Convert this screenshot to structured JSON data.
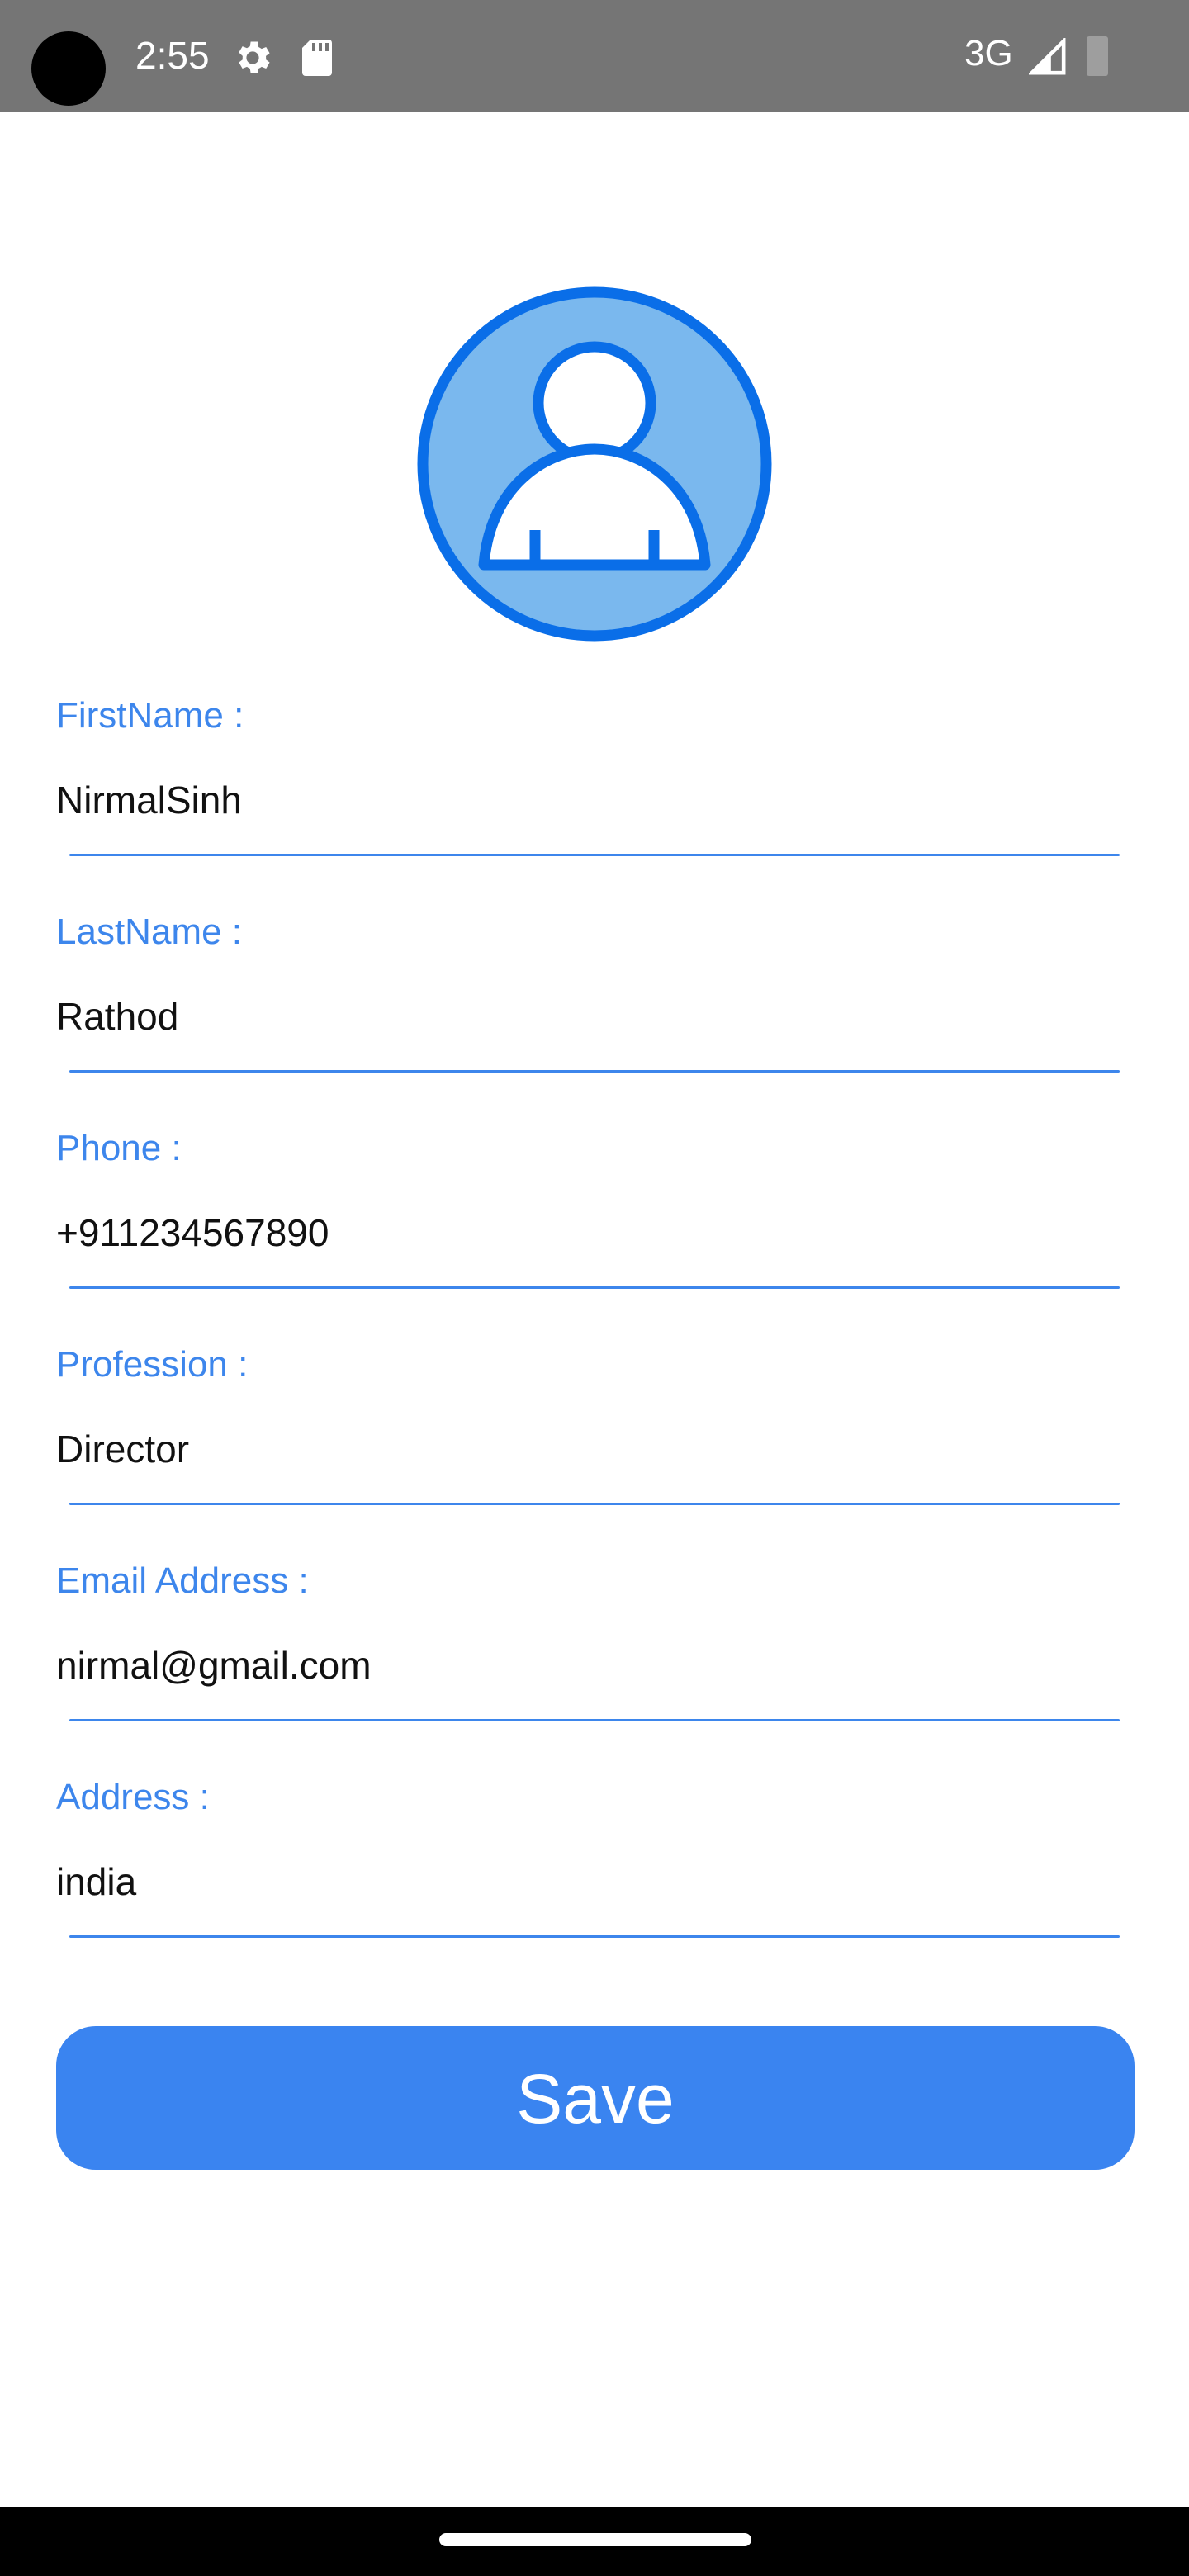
{
  "status_bar": {
    "time": "2:55",
    "network": "3G",
    "icons": [
      "gear-icon",
      "sd-card-icon",
      "signal-icon",
      "battery-icon"
    ]
  },
  "profile": {
    "avatar_icon": "user-avatar-icon",
    "fields": [
      {
        "label": "FirstName :",
        "value": "NirmalSinh"
      },
      {
        "label": "LastName :",
        "value": "Rathod"
      },
      {
        "label": "Phone :",
        "value": "+911234567890"
      },
      {
        "label": "Profession :",
        "value": "Director"
      },
      {
        "label": "Email Address :",
        "value": "nirmal@gmail.com"
      },
      {
        "label": "Address :",
        "value": "india"
      }
    ],
    "save_label": "Save"
  },
  "colors": {
    "accent": "#3d86ec",
    "button": "#3a84f0",
    "avatar_fill": "#7ab8ee",
    "avatar_stroke": "#0a6ee8",
    "status_bar": "#757575"
  }
}
